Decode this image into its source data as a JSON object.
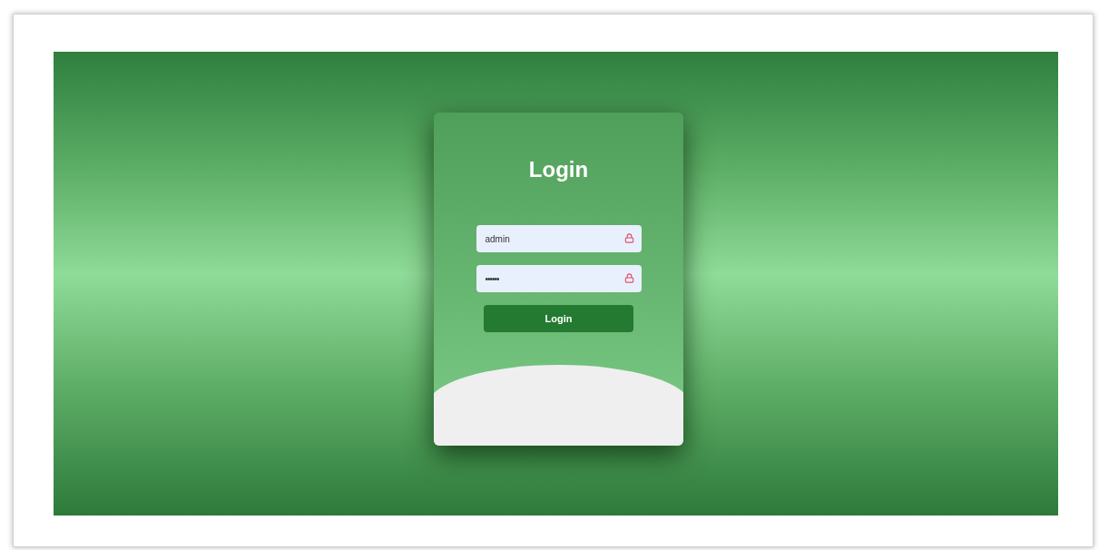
{
  "login_card": {
    "title": "Login",
    "fields": [
      {
        "kind": "text",
        "value": "admin"
      },
      {
        "kind": "password",
        "value": "••••••"
      }
    ],
    "button": "Login"
  }
}
